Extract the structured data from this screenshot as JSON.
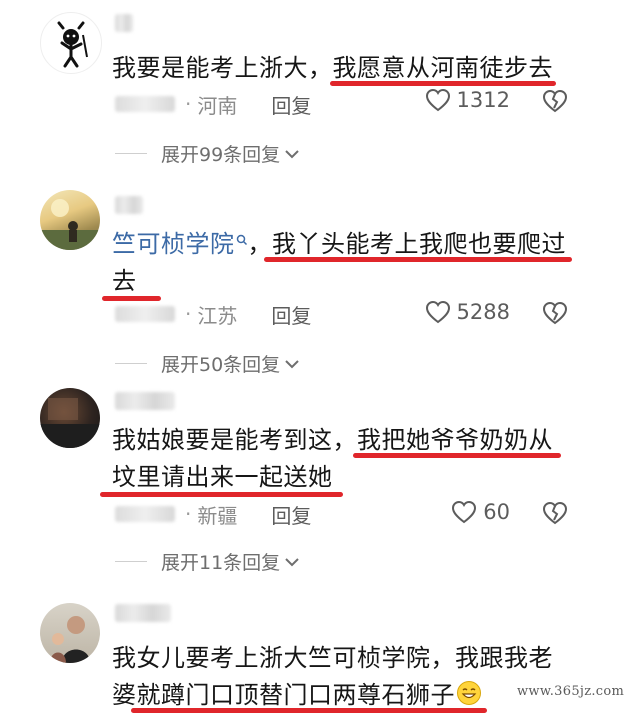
{
  "comments": [
    {
      "text_plain": "我要是能考上浙大，",
      "text_hl": "我愿意从河南徒步去",
      "location": "河南",
      "reply": "回复",
      "likes": "1312",
      "expand": "展开99条回复"
    },
    {
      "link": "竺可桢学院",
      "text_plain": "，",
      "text_hl_line1": "我丫头能考上我爬也要爬过",
      "text_hl_line2": "去",
      "location": "江苏",
      "reply": "回复",
      "likes": "5288",
      "expand": "展开50条回复"
    },
    {
      "text_plain": "我姑娘要是能考到这，",
      "text_hl_line1": "我把她爷爷奶奶从",
      "text_hl_line2": "坟里请出来一起送她",
      "location": "新疆",
      "reply": "回复",
      "likes": "60",
      "expand": "展开11条回复"
    },
    {
      "text_line1": "我女儿要考上浙大竺可桢学院，我跟我老",
      "text_line2_plain": "婆",
      "text_line2_hl": "就蹲门口顶替门口两尊石狮子"
    }
  ],
  "watermark": "www.365jz.com",
  "colors": {
    "underline": "#e0262b",
    "link": "#3c6aa6"
  },
  "icons": [
    "avatar-stickfigure",
    "heart-outline-icon",
    "dislike-heart-icon",
    "chevron-down-icon",
    "search-icon"
  ]
}
